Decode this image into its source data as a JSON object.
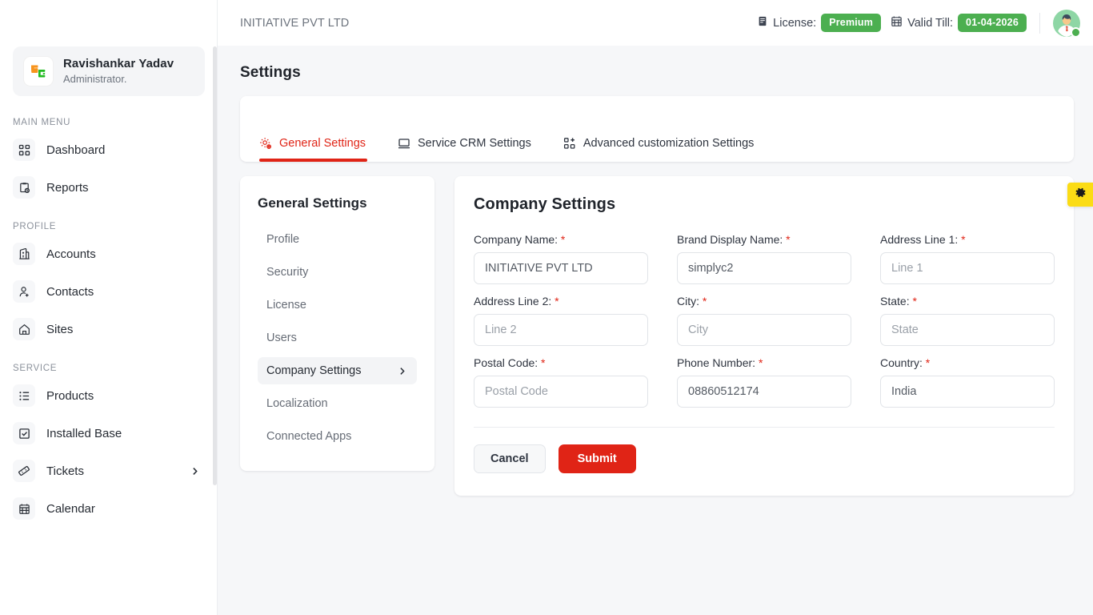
{
  "topbar": {
    "company": "INITIATIVE PVT LTD",
    "license_label": "License:",
    "license_value": "Premium",
    "valid_label": "Valid Till:",
    "valid_value": "01-04-2026",
    "license_icon": "license-book-icon",
    "calendar_icon": "calendar-icon",
    "avatar_icon": "user-avatar",
    "accent_green": "#4caf50"
  },
  "sidebar": {
    "profile": {
      "name": "Ravishankar Yadav",
      "role": "Administrator.",
      "logo_icon": "app-logo-icon"
    },
    "sections": [
      {
        "label": "MAIN MENU",
        "items": [
          {
            "label": "Dashboard",
            "icon": "dashboard-grid-icon",
            "chevron": false
          },
          {
            "label": "Reports",
            "icon": "reports-clipboard-icon",
            "chevron": false
          }
        ]
      },
      {
        "label": "PROFILE",
        "items": [
          {
            "label": "Accounts",
            "icon": "building-icon",
            "chevron": false
          },
          {
            "label": "Contacts",
            "icon": "user-add-icon",
            "chevron": false
          },
          {
            "label": "Sites",
            "icon": "home-icon",
            "chevron": false
          }
        ]
      },
      {
        "label": "SERVICE",
        "items": [
          {
            "label": "Products",
            "icon": "list-icon",
            "chevron": false
          },
          {
            "label": "Installed Base",
            "icon": "checkbox-square-icon",
            "chevron": false
          },
          {
            "label": "Tickets",
            "icon": "ticket-icon",
            "chevron": true
          },
          {
            "label": "Calendar",
            "icon": "calendar-grid-icon",
            "chevron": false
          }
        ]
      }
    ]
  },
  "page": {
    "title": "Settings"
  },
  "tabs": [
    {
      "label": "General Settings",
      "icon": "gear-settings-icon",
      "active": true
    },
    {
      "label": "Service CRM Settings",
      "icon": "monitor-icon",
      "active": false
    },
    {
      "label": "Advanced customization Settings",
      "icon": "grid-plus-icon",
      "active": false
    }
  ],
  "subnav": {
    "title": "General Settings",
    "items": [
      {
        "label": "Profile",
        "active": false,
        "chevron": false
      },
      {
        "label": "Security",
        "active": false,
        "chevron": false
      },
      {
        "label": "License",
        "active": false,
        "chevron": false
      },
      {
        "label": "Users",
        "active": false,
        "chevron": false
      },
      {
        "label": "Company Settings",
        "active": true,
        "chevron": true
      },
      {
        "label": "Localization",
        "active": false,
        "chevron": false
      },
      {
        "label": "Connected Apps",
        "active": false,
        "chevron": false
      }
    ]
  },
  "form": {
    "title": "Company Settings",
    "fields": [
      {
        "label": "Company Name:",
        "required": true,
        "value": "INITIATIVE PVT LTD",
        "placeholder": "Company Name",
        "name": "company-name"
      },
      {
        "label": "Brand Display Name:",
        "required": true,
        "value": "simplyc2",
        "placeholder": "Brand Display Name",
        "name": "brand-display-name"
      },
      {
        "label": "Address Line 1:",
        "required": true,
        "value": "",
        "placeholder": "Line 1",
        "name": "address-line-1"
      },
      {
        "label": "Address Line 2:",
        "required": true,
        "value": "",
        "placeholder": "Line 2",
        "name": "address-line-2"
      },
      {
        "label": "City:",
        "required": true,
        "value": "",
        "placeholder": "City",
        "name": "city"
      },
      {
        "label": "State:",
        "required": true,
        "value": "",
        "placeholder": "State",
        "name": "state"
      },
      {
        "label": "Postal Code:",
        "required": true,
        "value": "",
        "placeholder": "Postal Code",
        "name": "postal-code"
      },
      {
        "label": "Phone Number:",
        "required": true,
        "value": "08860512174",
        "placeholder": "Phone Number",
        "name": "phone-number"
      },
      {
        "label": "Country:",
        "required": true,
        "value": "India",
        "placeholder": "Country",
        "name": "country"
      }
    ],
    "cancel_label": "Cancel",
    "submit_label": "Submit",
    "submit_color": "#e02416"
  },
  "float_widget": {
    "icon": "gear-icon",
    "color": "#fbdc15"
  }
}
